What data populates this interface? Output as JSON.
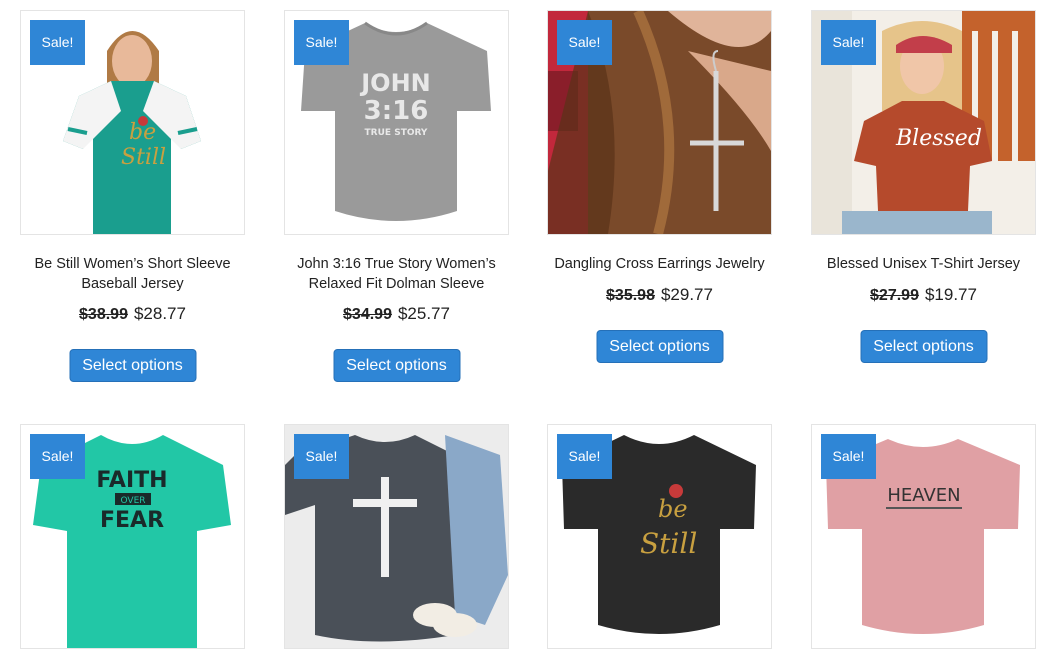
{
  "products": [
    {
      "sale": "Sale!",
      "title1": "Be Still Women’s Short Sleeve",
      "title2": "Baseball Jersey",
      "old_price": "$38.99",
      "price": "$28.77",
      "button": "Select options"
    },
    {
      "sale": "Sale!",
      "title1": "John 3:16 True Story Women’s",
      "title2": "Relaxed Fit Dolman Sleeve",
      "old_price": "$34.99",
      "price": "$25.77",
      "button": "Select options",
      "art_line1": "JOHN",
      "art_line2": "3:16",
      "art_line3": "TRUE STORY"
    },
    {
      "sale": "Sale!",
      "title1": "Dangling Cross Earrings Jewelry",
      "title2": "",
      "old_price": "$35.98",
      "price": "$29.77",
      "button": "Select options"
    },
    {
      "sale": "Sale!",
      "title1": "Blessed Unisex T-Shirt Jersey",
      "title2": "",
      "old_price": "$27.99",
      "price": "$19.77",
      "button": "Select options",
      "art_line1": "Blessed"
    },
    {
      "sale": "Sale!",
      "art_line1": "FAITH",
      "art_line2": "OVER",
      "art_line3": "FEAR"
    },
    {
      "sale": "Sale!"
    },
    {
      "sale": "Sale!"
    },
    {
      "sale": "Sale!",
      "art_line1": "HEAVEN"
    }
  ],
  "colors": {
    "accent": "#2f86d6"
  }
}
